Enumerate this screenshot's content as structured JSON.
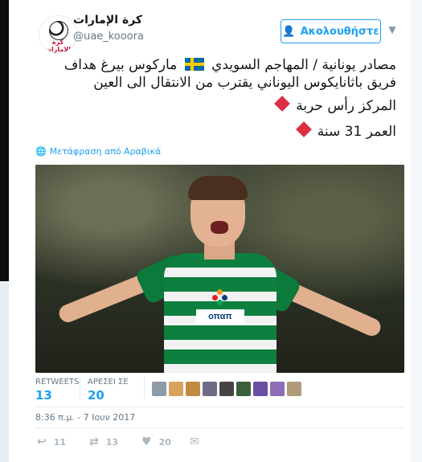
{
  "header": {
    "display_name": "كرة الإمارات",
    "handle": "@uae_kooora",
    "follow_label": "Ακολουθήστε",
    "follow_icon": "add-user-icon",
    "avatar_text": "كرة الإمارات"
  },
  "tweet": {
    "line1_part1": "مصادر يونانية / المهاجم السويدي",
    "line1_part2": "ماركوس بيرغ هداف",
    "line2": "فريق باثانايكوس اليوناني يقترب من الانتقال الى العين",
    "line3": "المركز رأس حربة",
    "line4": "العمر 31 سنة",
    "translate_label": "Μετάφραση από Αραβικά",
    "photo_sponsor": "οπαπ"
  },
  "stats": {
    "retweets_label": "RETWEETS",
    "retweets_value": "13",
    "likes_label": "ΑΡΕΣΕΙ ΣΕ",
    "likes_value": "20",
    "liker_avatar_colors": [
      "#8e9aa6",
      "#d9a35e",
      "#c28b3f",
      "#6f6a85",
      "#444444",
      "#3b5f3a",
      "#6a4ea3",
      "#8f6bb8",
      "#b09a7a"
    ]
  },
  "timestamp": "8:36 π.μ. - 7 Ιουν 2017",
  "actions": {
    "reply_count": "11",
    "retweet_count": "13",
    "like_count": "20"
  },
  "colors": {
    "accent": "#1da1f2",
    "diamond": "#dd2e44",
    "muted": "#657786"
  }
}
